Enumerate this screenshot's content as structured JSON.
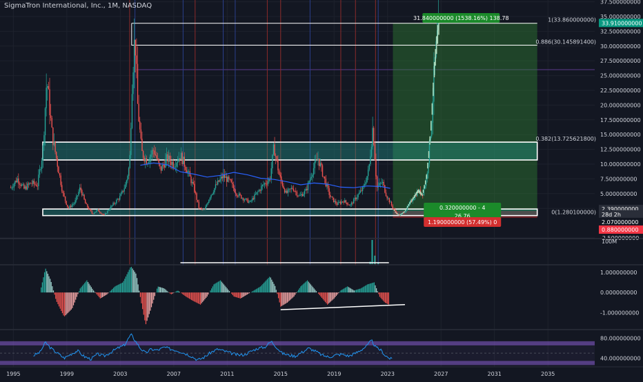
{
  "header": {
    "title": "SigmaTron International, Inc., 1M, NASDAQ"
  },
  "colors": {
    "background": "#131722",
    "up": "#26a69a",
    "down": "#ef5350",
    "ma": "#2962ff",
    "fib": "#ffffff",
    "profit_zone": "#1b5e20",
    "rsi_line": "#2196f3",
    "rsi_band": "#7e57c2",
    "accent_green": "#089981",
    "accent_red": "#f23645"
  },
  "chart_data": [
    {
      "type": "candlestick",
      "pane": "price",
      "title": "SigmaTron International, Inc., 1M, NASDAQ",
      "x_ticks": [
        "1995",
        "1999",
        "2003",
        "2007",
        "2011",
        "2015",
        "2019",
        "2023",
        "2027",
        "2031",
        "2035"
      ],
      "x_range": [
        1994.0,
        2038.5
      ],
      "y_ticks": [
        "37.500000000",
        "35.000000000",
        "32.500000000",
        "30.000000000",
        "27.500000000",
        "25.000000000",
        "22.500000000",
        "20.000000000",
        "17.500000000",
        "15.000000000",
        "12.500000000",
        "10.000000000",
        "7.500000000",
        "5.000000000",
        "2.500000000",
        "-2.500000000"
      ],
      "y_range": [
        -2.5,
        37.8
      ],
      "price_path": [
        [
          1994.8,
          6.0
        ],
        [
          1995.3,
          7.5
        ],
        [
          1995.8,
          5.8
        ],
        [
          1996.3,
          6.8
        ],
        [
          1996.8,
          6.5
        ],
        [
          1997.2,
          12
        ],
        [
          1997.5,
          24.5
        ],
        [
          1997.9,
          15
        ],
        [
          1998.3,
          10
        ],
        [
          1998.7,
          5
        ],
        [
          1999.1,
          2.5
        ],
        [
          1999.6,
          3.5
        ],
        [
          2000.0,
          6
        ],
        [
          2000.4,
          3.2
        ],
        [
          2000.9,
          1.6
        ],
        [
          2001.3,
          2.2
        ],
        [
          2001.8,
          1.3
        ],
        [
          2002.2,
          2.5
        ],
        [
          2002.6,
          3.5
        ],
        [
          2003.0,
          4.5
        ],
        [
          2003.4,
          6.5
        ],
        [
          2003.7,
          10
        ],
        [
          2003.9,
          25
        ],
        [
          2004.1,
          32
        ],
        [
          2004.3,
          20
        ],
        [
          2004.6,
          12
        ],
        [
          2005.0,
          10.5
        ],
        [
          2005.5,
          12.5
        ],
        [
          2006.0,
          9
        ],
        [
          2006.5,
          11
        ],
        [
          2007.0,
          10
        ],
        [
          2007.5,
          11.5
        ],
        [
          2008.0,
          9
        ],
        [
          2008.5,
          6
        ],
        [
          2008.9,
          2.5
        ],
        [
          2009.3,
          2.2
        ],
        [
          2009.7,
          4.5
        ],
        [
          2010.2,
          6.5
        ],
        [
          2010.7,
          8
        ],
        [
          2011.2,
          7
        ],
        [
          2011.7,
          5
        ],
        [
          2012.2,
          4.2
        ],
        [
          2012.7,
          3.5
        ],
        [
          2013.2,
          5
        ],
        [
          2013.7,
          6.5
        ],
        [
          2014.2,
          7.5
        ],
        [
          2014.5,
          13
        ],
        [
          2014.9,
          8
        ],
        [
          2015.4,
          5
        ],
        [
          2015.9,
          6
        ],
        [
          2016.4,
          4.5
        ],
        [
          2016.9,
          5.5
        ],
        [
          2017.4,
          9
        ],
        [
          2017.8,
          11
        ],
        [
          2018.2,
          8
        ],
        [
          2018.7,
          4.5
        ],
        [
          2019.2,
          3.2
        ],
        [
          2019.7,
          3.8
        ],
        [
          2020.2,
          3
        ],
        [
          2020.7,
          4.5
        ],
        [
          2021.2,
          6
        ],
        [
          2021.6,
          9
        ],
        [
          2021.9,
          16.5
        ],
        [
          2022.2,
          6
        ],
        [
          2022.6,
          7
        ],
        [
          2022.9,
          4.8
        ],
        [
          2023.3,
          3
        ],
        [
          2023.6,
          1.8
        ],
        [
          2023.9,
          1.3
        ],
        [
          2024.3,
          2
        ],
        [
          2024.7,
          3.5
        ],
        [
          2025.0,
          4.5
        ],
        [
          2025.3,
          5.5
        ],
        [
          2025.6,
          4.8
        ],
        [
          2025.9,
          7.5
        ],
        [
          2026.1,
          12
        ],
        [
          2026.3,
          18
        ],
        [
          2026.5,
          26
        ],
        [
          2026.7,
          31
        ],
        [
          2026.85,
          33.9
        ]
      ],
      "moving_average": [
        [
          2004.5,
          9.8
        ],
        [
          2005.5,
          10.2
        ],
        [
          2006.5,
          9.9
        ],
        [
          2007.5,
          8.7
        ],
        [
          2008.5,
          8.3
        ],
        [
          2009.5,
          7.8
        ],
        [
          2010.5,
          8.1
        ],
        [
          2011.5,
          8.6
        ],
        [
          2012.5,
          8.2
        ],
        [
          2013.5,
          7.6
        ],
        [
          2014.5,
          7.4
        ],
        [
          2015.5,
          7.0
        ],
        [
          2016.5,
          6.5
        ],
        [
          2017.5,
          6.8
        ],
        [
          2018.5,
          6.6
        ],
        [
          2019.5,
          6.1
        ],
        [
          2020.5,
          6.0
        ],
        [
          2021.5,
          6.3
        ],
        [
          2022.5,
          6.2
        ],
        [
          2023.2,
          5.9
        ]
      ],
      "fib_levels": [
        {
          "label": "1(33.860000000)",
          "value": 33.86
        },
        {
          "label": "0.886(30.145891400)",
          "value": 30.1458914
        },
        {
          "label": "0.382(13.725621800)",
          "value": 13.7256218
        },
        {
          "label": "0(1.280100000)",
          "value": 1.2801
        }
      ],
      "fib_start_x": 2003.85,
      "fib_end_x": 2034.2,
      "zones": [
        {
          "x1": 1997.2,
          "x2": 2034.2,
          "y1": 13.7256218,
          "y2": 10.7
        },
        {
          "x1": 1997.2,
          "x2": 2034.2,
          "y1": 2.39,
          "y2": 1.28
        }
      ],
      "position": {
        "x1": 2023.4,
        "x2": 2034.2,
        "entry": 2.07,
        "target": 33.91,
        "stop": 0.88,
        "profit_label": "31.840000000 (1538.16%) 138.78",
        "entry_label_1": "0.320000000 - 4",
        "entry_label_2": "26.76",
        "loss_label": "1.190000000 (57.49%) 0"
      },
      "price_tags": [
        {
          "text": "33.910000000",
          "value": 33.91,
          "color": "#089981"
        },
        {
          "text": "2.390000000",
          "value": 2.39,
          "color": "#2a2e39"
        },
        {
          "text": "28d 2h",
          "value": 1.5,
          "color": "#2a2e39"
        },
        {
          "text": "2.070000000",
          "value": 0.2,
          "color": "#131722"
        },
        {
          "text": "0.880000000",
          "value": -1.1,
          "color": "#f23645"
        }
      ],
      "vertical_lines": [
        {
          "x": 2003.7,
          "color": "red"
        },
        {
          "x": 2004.1,
          "color": "blue"
        },
        {
          "x": 2007.7,
          "color": "blue"
        },
        {
          "x": 2008.6,
          "color": "red"
        },
        {
          "x": 2010.7,
          "color": "blue"
        },
        {
          "x": 2011.6,
          "color": "blue"
        },
        {
          "x": 2014.0,
          "color": "red"
        },
        {
          "x": 2015.0,
          "color": "red"
        },
        {
          "x": 2017.2,
          "color": "blue"
        },
        {
          "x": 2019.5,
          "color": "red"
        },
        {
          "x": 2020.6,
          "color": "red"
        },
        {
          "x": 2022.1,
          "color": "red"
        },
        {
          "x": 2022.3,
          "color": "blue"
        }
      ]
    },
    {
      "type": "bar",
      "pane": "volume",
      "y_ticks": [
        "100M"
      ],
      "values": [
        [
          2021.85,
          1.0
        ],
        [
          2022.05,
          0.35
        ],
        [
          2021.7,
          0.1
        ],
        [
          2022.3,
          0.08
        ]
      ],
      "trendline": [
        [
          2007.5,
          0.05
        ],
        [
          2023.1,
          0.05
        ]
      ]
    },
    {
      "type": "bar",
      "pane": "macd",
      "y_ticks": [
        "1.000000000",
        "0.000000000",
        "-1.000000000"
      ],
      "y_range": [
        -1.8,
        1.3
      ],
      "histogram_path": [
        [
          1997.0,
          0.0
        ],
        [
          1997.4,
          1.2
        ],
        [
          1997.8,
          0.6
        ],
        [
          1998.2,
          -0.4
        ],
        [
          1998.8,
          -1.2
        ],
        [
          1999.4,
          -0.8
        ],
        [
          2000.0,
          0.2
        ],
        [
          2000.5,
          0.6
        ],
        [
          2001.0,
          0.1
        ],
        [
          2001.5,
          -0.3
        ],
        [
          2002.0,
          -0.1
        ],
        [
          2002.6,
          0.3
        ],
        [
          2003.2,
          0.5
        ],
        [
          2003.8,
          1.3
        ],
        [
          2004.2,
          0.9
        ],
        [
          2004.6,
          -0.6
        ],
        [
          2004.9,
          -1.6
        ],
        [
          2005.3,
          -0.8
        ],
        [
          2005.8,
          0.3
        ],
        [
          2006.3,
          0.2
        ],
        [
          2006.8,
          -0.1
        ],
        [
          2007.3,
          0.1
        ],
        [
          2007.9,
          -0.2
        ],
        [
          2008.4,
          -0.4
        ],
        [
          2009.0,
          -0.6
        ],
        [
          2009.5,
          -0.2
        ],
        [
          2010.0,
          0.4
        ],
        [
          2010.5,
          0.6
        ],
        [
          2011.0,
          0.2
        ],
        [
          2011.5,
          -0.2
        ],
        [
          2012.0,
          -0.3
        ],
        [
          2012.5,
          -0.1
        ],
        [
          2013.0,
          0.1
        ],
        [
          2013.5,
          0.3
        ],
        [
          2014.2,
          0.8
        ],
        [
          2014.6,
          0.3
        ],
        [
          2015.0,
          -0.7
        ],
        [
          2015.5,
          -0.5
        ],
        [
          2016.0,
          -0.2
        ],
        [
          2016.5,
          0.3
        ],
        [
          2017.0,
          0.6
        ],
        [
          2017.5,
          0.2
        ],
        [
          2018.0,
          -0.2
        ],
        [
          2018.5,
          -0.6
        ],
        [
          2019.0,
          -0.3
        ],
        [
          2019.5,
          0.1
        ],
        [
          2020.0,
          0.3
        ],
        [
          2020.5,
          0.1
        ],
        [
          2021.0,
          0.2
        ],
        [
          2021.5,
          0.4
        ],
        [
          2022.0,
          0.5
        ],
        [
          2022.4,
          -0.2
        ],
        [
          2022.8,
          -0.5
        ],
        [
          2023.1,
          -0.6
        ]
      ],
      "trendline": [
        [
          2015.0,
          -0.85
        ],
        [
          2024.3,
          -0.6
        ]
      ]
    },
    {
      "type": "line",
      "pane": "rsi",
      "y_ticks": [
        "80.000000000",
        "40.000000000"
      ],
      "y_range": [
        25,
        95
      ],
      "series": [
        {
          "values": [
            [
              1996.5,
              45
            ],
            [
              1997.0,
              52
            ],
            [
              1997.4,
              72
            ],
            [
              1997.8,
              60
            ],
            [
              1998.3,
              50
            ],
            [
              1998.8,
              40
            ],
            [
              1999.3,
              48
            ],
            [
              1999.8,
              55
            ],
            [
              2000.3,
              43
            ],
            [
              2000.8,
              38
            ],
            [
              2001.3,
              48
            ],
            [
              2001.8,
              44
            ],
            [
              2002.3,
              52
            ],
            [
              2002.8,
              60
            ],
            [
              2003.3,
              66
            ],
            [
              2003.8,
              88
            ],
            [
              2004.1,
              76
            ],
            [
              2004.5,
              60
            ],
            [
              2004.9,
              50
            ],
            [
              2005.3,
              58
            ],
            [
              2005.8,
              56
            ],
            [
              2006.3,
              62
            ],
            [
              2006.8,
              58
            ],
            [
              2007.3,
              55
            ],
            [
              2007.8,
              50
            ],
            [
              2008.3,
              44
            ],
            [
              2008.8,
              36
            ],
            [
              2009.3,
              42
            ],
            [
              2009.8,
              52
            ],
            [
              2010.3,
              58
            ],
            [
              2010.8,
              54
            ],
            [
              2011.3,
              50
            ],
            [
              2011.8,
              46
            ],
            [
              2012.3,
              47
            ],
            [
              2012.8,
              54
            ],
            [
              2013.3,
              60
            ],
            [
              2013.8,
              62
            ],
            [
              2014.3,
              74
            ],
            [
              2014.7,
              62
            ],
            [
              2015.1,
              50
            ],
            [
              2015.6,
              46
            ],
            [
              2016.1,
              44
            ],
            [
              2016.6,
              52
            ],
            [
              2017.1,
              60
            ],
            [
              2017.6,
              54
            ],
            [
              2018.1,
              46
            ],
            [
              2018.6,
              42
            ],
            [
              2019.1,
              46
            ],
            [
              2019.6,
              48
            ],
            [
              2020.1,
              44
            ],
            [
              2020.6,
              50
            ],
            [
              2021.1,
              58
            ],
            [
              2021.5,
              66
            ],
            [
              2021.8,
              76
            ],
            [
              2022.1,
              62
            ],
            [
              2022.5,
              56
            ],
            [
              2022.8,
              46
            ],
            [
              2023.1,
              40
            ],
            [
              2023.4,
              37
            ]
          ]
        }
      ],
      "bands": [
        70,
        30
      ]
    }
  ]
}
